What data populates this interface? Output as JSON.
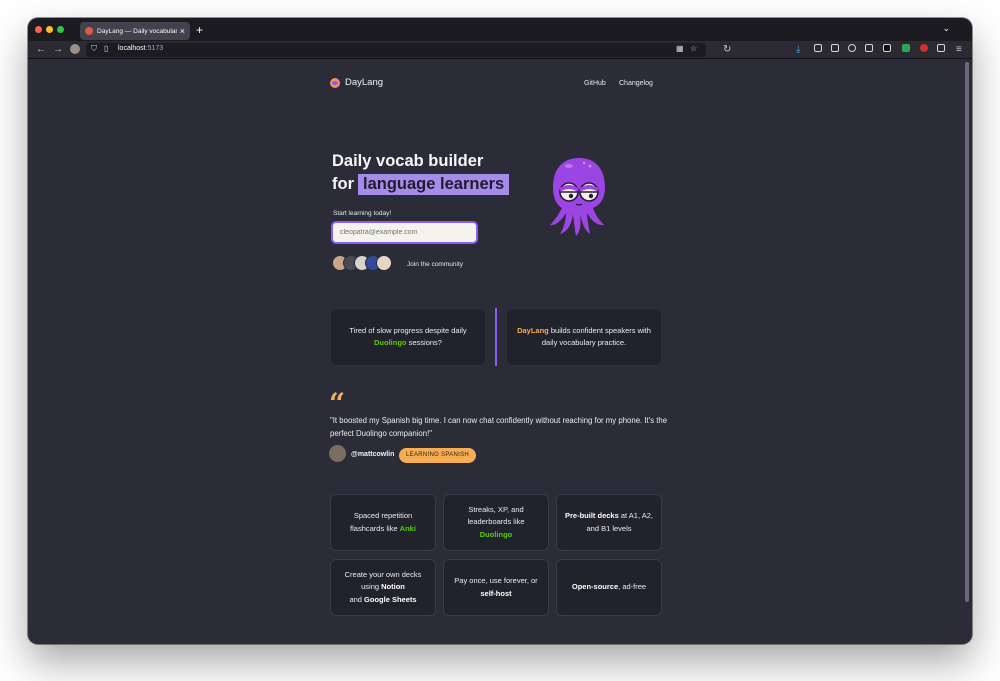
{
  "browser": {
    "tab_title": "DayLang — Daily vocabulary builder",
    "new_tab": "+",
    "close": "×",
    "url_host": "localhost",
    "url_port": ":5173",
    "tab_list": "⌄"
  },
  "nav": {
    "brand": "DayLang",
    "links": [
      "GitHub",
      "Changelog"
    ]
  },
  "hero": {
    "line1": "Daily vocab builder",
    "line2_prefix": "for",
    "line2_highlight": "language learners",
    "start_label": "Start learning today!",
    "email_placeholder": "cleopatra@example.com",
    "join_text": "Join the community"
  },
  "comparison": {
    "problem_pre": "Tired of slow progress despite daily",
    "problem_brand": "Duolingo",
    "problem_post": "sessions?",
    "solution_brand": "DayLang",
    "solution_text": "builds confident speakers with daily vocabulary practice."
  },
  "testimonial": {
    "quote_mark": "“",
    "text": "\"It boosted my Spanish big time. I can now chat confidently without reaching for my phone. It's the perfect Duolingo companion!\"",
    "handle": "@mattcowlin",
    "badge": "LEARNING SPANISH"
  },
  "features": [
    {
      "pre": "Spaced repetition flashcards like",
      "em": "Anki",
      "post": "",
      "em_style": "green"
    },
    {
      "pre": "Streaks, XP, and leaderboards like",
      "em": "Duolingo",
      "post": "",
      "em_style": "green"
    },
    {
      "pre": "",
      "em": "Pre-built decks",
      "post": "at A1, A2, and B1 levels",
      "em_style": "bold"
    },
    {
      "pre": "Create your own decks using",
      "em": "Notion",
      "mid": "and",
      "em2": "Google Sheets",
      "em_style": "bold"
    },
    {
      "pre": "Pay once, use forever, or",
      "em": "self-host",
      "post": "",
      "em_style": "bold"
    },
    {
      "pre": "",
      "em": "Open-source",
      "post": ", ad-free",
      "em_style": "bold"
    }
  ],
  "colors": {
    "accent_purple": "#8b5cf6",
    "highlight": "#a48ce8",
    "duolingo_green": "#58cc02",
    "orange": "#f6ad55",
    "page_bg": "#2b2c38"
  }
}
